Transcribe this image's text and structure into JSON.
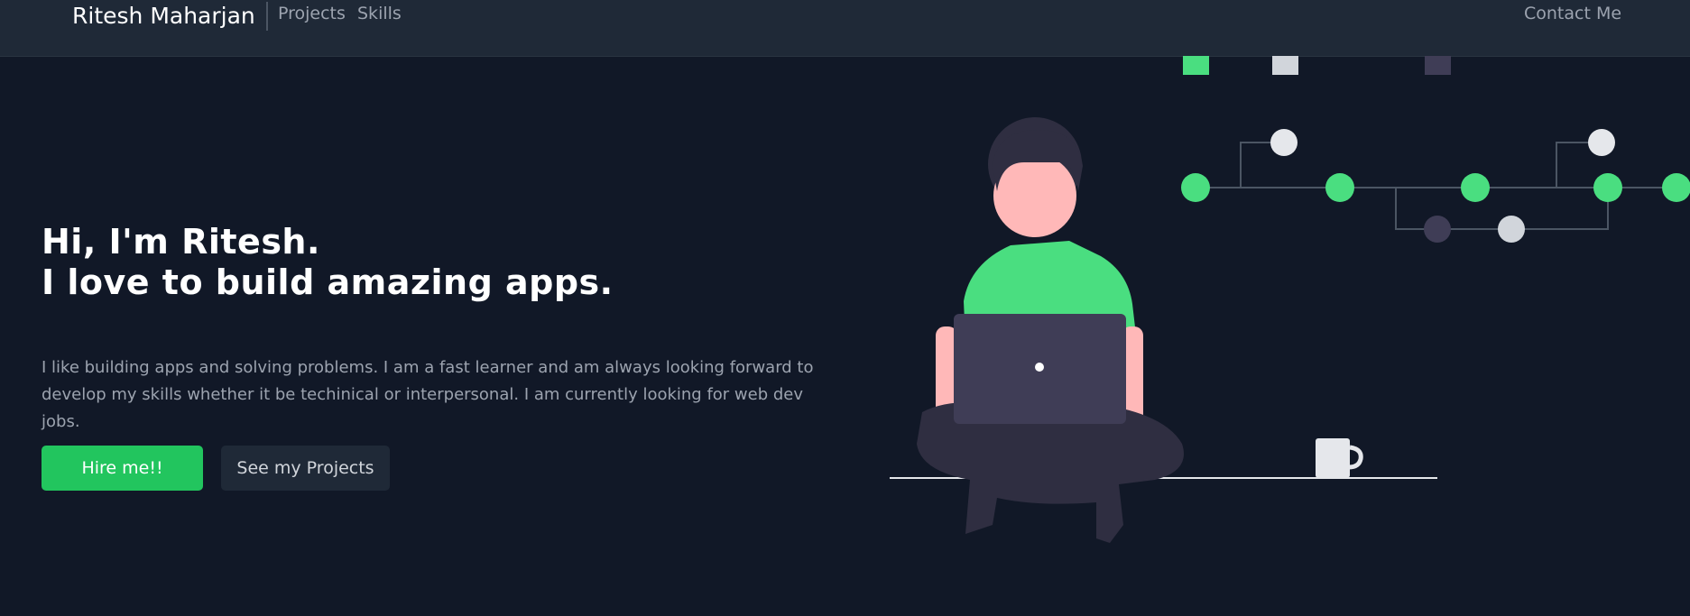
{
  "nav": {
    "brand": "Ritesh Maharjan",
    "links": [
      {
        "label": "Projects"
      },
      {
        "label": "Skills"
      }
    ],
    "contact": "Contact Me"
  },
  "hero": {
    "title_line1": "Hi, I'm Ritesh.",
    "title_line2": "I love to build amazing apps.",
    "description": "I like building apps and solving problems. I am a fast learner and am always looking forward to develop my skills whether it be techinical or interpersonal. I am currently looking for web dev jobs.",
    "primary_button": "Hire me!!",
    "secondary_button": "See my Projects"
  },
  "colors": {
    "background": "#111827",
    "navbar": "#1f2937",
    "accent_green": "#22c55e",
    "illustration_green": "#4ade80"
  },
  "illustration": {
    "icon": "developer-with-laptop-illustration"
  }
}
